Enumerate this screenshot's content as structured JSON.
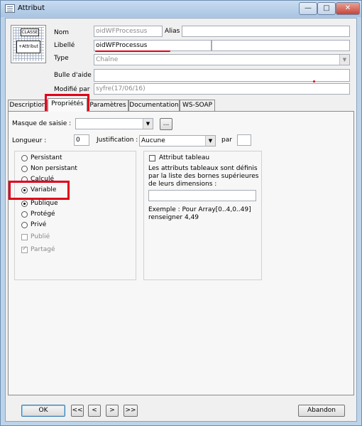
{
  "window": {
    "title": "Attribut",
    "min": "—",
    "max": "□",
    "close": "✕"
  },
  "icon": {
    "class_label": "CLASSE",
    "attr_label": "+Attribut"
  },
  "header": {
    "nom_label": "Nom",
    "nom_value": "oidWFProcessus",
    "alias_label": "Alias",
    "alias_value": "",
    "libelle_label": "Libellé",
    "libelle_value": "oidWFProcessus",
    "libelle_extra": "",
    "type_label": "Type",
    "type_value": "Chaîne",
    "bulle_label": "Bulle d'aide",
    "bulle_value": "",
    "modifie_label": "Modifié par",
    "modifie_value": "syfre(17/06/16)"
  },
  "tabs": [
    "Description",
    "Propriétés",
    "Paramètres",
    "Documentation",
    "WS-SOAP"
  ],
  "props": {
    "masque_label": "Masque de saisie :",
    "masque_value": "",
    "masque_btn": "...",
    "longueur_label": "Longueur :",
    "longueur_value": "0",
    "justif_label": "Justification :",
    "justif_value": "Aucune",
    "par_label": "par",
    "par_value": ""
  },
  "left_group": {
    "persistant": "Persistant",
    "non_persistant": "Non persistant",
    "calcule": "Calculé",
    "variable": "Variable",
    "publique": "Publique",
    "protege": "Protégé",
    "prive": "Privé",
    "publie": "Publié",
    "partage": "Partagé"
  },
  "right_group": {
    "tableau_label": "Attribut tableau",
    "desc": "Les attributs tableaux sont définis par la liste des bornes supérieures de leurs dimensions :",
    "input_value": "",
    "exemple": "Exemple : Pour Array[0..4,0..49] renseigner 4,49"
  },
  "footer": {
    "ok": "OK",
    "first": "<<",
    "prev": "<",
    "next": ">",
    "last": ">>",
    "abandon": "Abandon"
  },
  "colors": {
    "annotation": "#e0001a"
  }
}
